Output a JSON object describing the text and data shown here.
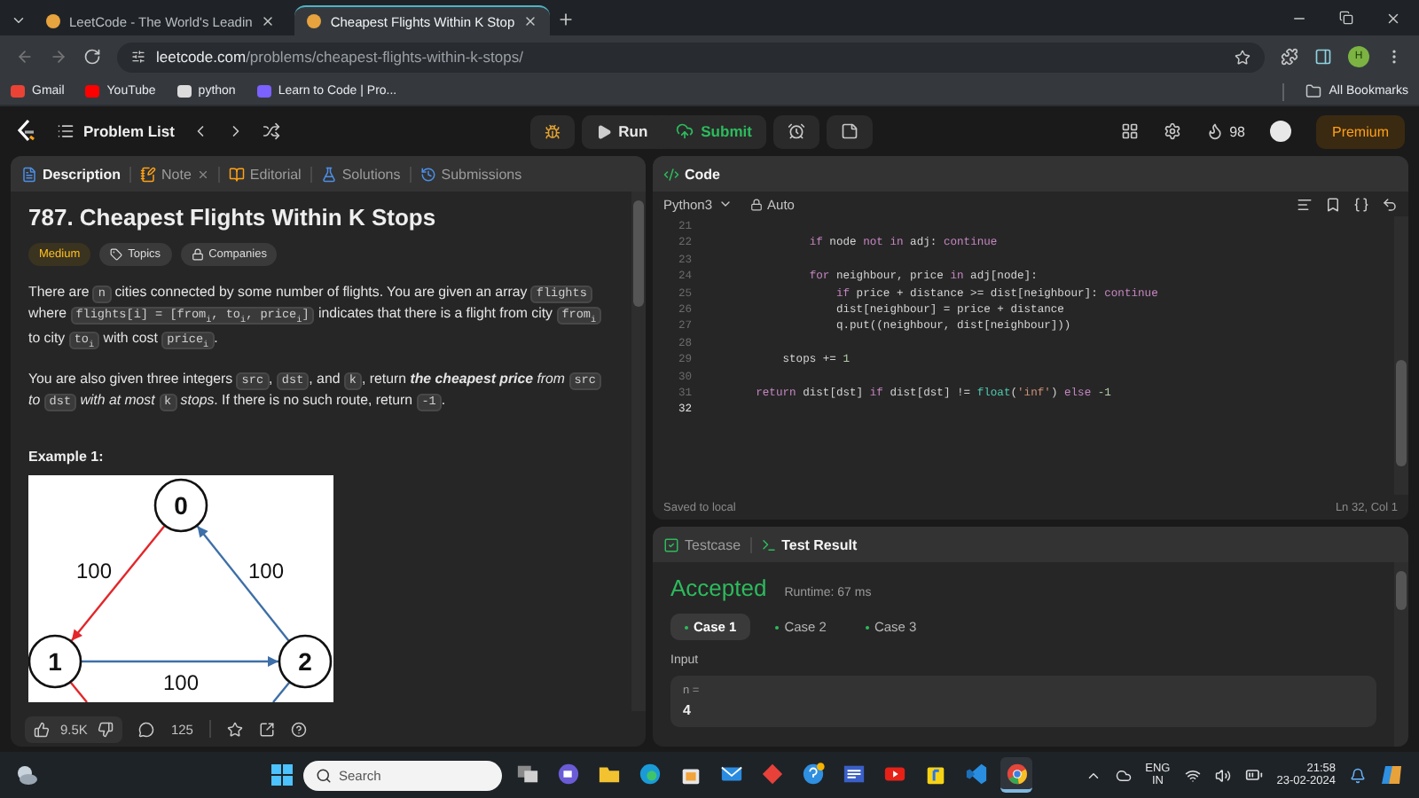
{
  "browser": {
    "tabs": [
      {
        "title": "LeetCode - The World's Leadin",
        "selected": false
      },
      {
        "title": "Cheapest Flights Within K Stop",
        "selected": true
      }
    ],
    "address": {
      "domain": "leetcode.com",
      "path": "/problems/cheapest-flights-within-k-stops/"
    },
    "profile_initial": "H",
    "bookmarks": [
      {
        "label": "Gmail",
        "kind": "gmail"
      },
      {
        "label": "YouTube",
        "kind": "youtube"
      },
      {
        "label": "python",
        "kind": "page"
      },
      {
        "label": "Learn to Code | Pro...",
        "kind": "learn"
      }
    ],
    "all_bookmarks": "All Bookmarks"
  },
  "navbar": {
    "problem_list": "Problem List",
    "run": "Run",
    "submit": "Submit",
    "streak": "98",
    "premium": "Premium"
  },
  "description": {
    "tabs": [
      {
        "label": "Description",
        "kind": "description",
        "selected": true
      },
      {
        "label": "Note",
        "kind": "note",
        "selected": false
      },
      {
        "label": "Editorial",
        "kind": "editorial",
        "selected": false
      },
      {
        "label": "Solutions",
        "kind": "solutions",
        "selected": false
      },
      {
        "label": "Submissions",
        "kind": "submissions",
        "selected": false
      }
    ],
    "title": "787. Cheapest Flights Within K Stops",
    "tags": [
      {
        "label": "Medium",
        "kind": "difficulty"
      },
      {
        "label": "Topics",
        "kind": "topics"
      },
      {
        "label": "Companies",
        "kind": "companies"
      }
    ],
    "paragraphs": [
      [
        {
          "kind": "text",
          "text": "There are "
        },
        {
          "kind": "code",
          "text": "n"
        },
        {
          "kind": "text",
          "text": " cities connected by some number of flights. You are given an array "
        },
        {
          "kind": "code",
          "text": "flights"
        },
        {
          "kind": "text",
          "text": " where "
        },
        {
          "kind": "code",
          "text": "flights[i] = [from$_{i}$, to$_{i}$, price$_{i}$]"
        },
        {
          "kind": "text",
          "text": " indicates that there is a flight from city "
        },
        {
          "kind": "code",
          "text": "from$_{i}$"
        },
        {
          "kind": "text",
          "text": " to city "
        },
        {
          "kind": "code",
          "text": "to$_{i}$"
        },
        {
          "kind": "text",
          "text": " with cost "
        },
        {
          "kind": "code",
          "text": "price$_{i}$"
        },
        {
          "kind": "text",
          "text": "."
        }
      ],
      [
        {
          "kind": "text",
          "text": "You are also given three integers "
        },
        {
          "kind": "code",
          "text": "src"
        },
        {
          "kind": "text",
          "text": ", "
        },
        {
          "kind": "code",
          "text": "dst"
        },
        {
          "kind": "text",
          "text": ", and "
        },
        {
          "kind": "code",
          "text": "k"
        },
        {
          "kind": "text",
          "text": ", return "
        },
        {
          "kind": "strong",
          "text": "the cheapest price"
        },
        {
          "kind": "italic",
          "text": " from "
        },
        {
          "kind": "code",
          "text": "src"
        },
        {
          "kind": "italic",
          "text": " to "
        },
        {
          "kind": "code",
          "text": "dst"
        },
        {
          "kind": "italic",
          "text": " with at most "
        },
        {
          "kind": "code",
          "text": "k"
        },
        {
          "kind": "italic",
          "text": " stops"
        },
        {
          "kind": "text",
          "text": ". If there is no such route, return "
        },
        {
          "kind": "code",
          "text": "-1"
        },
        {
          "kind": "text",
          "text": "."
        }
      ]
    ],
    "example_heading": "Example 1:",
    "graph": {
      "nodes": [
        {
          "label": "0"
        },
        {
          "label": "1"
        },
        {
          "label": "2"
        }
      ],
      "edges": [
        {
          "label": "100",
          "color": "#e3262a"
        },
        {
          "label": "100",
          "color": "#3d6fa8"
        },
        {
          "label": "100",
          "color": "#3d6fa8"
        }
      ]
    },
    "likes": "9.5K",
    "comments": "125"
  },
  "editor": {
    "title": "Code",
    "language": "Python3",
    "mode": "Auto",
    "lines": [
      {
        "number": "21",
        "current": false
      },
      {
        "number": "22",
        "current": false,
        "segments": [
          {
            "kind": "kw",
            "text": "            if"
          },
          {
            "kind": "plain",
            "text": " node "
          },
          {
            "kind": "kw",
            "text": "not in"
          },
          {
            "kind": "plain",
            "text": " adj: "
          },
          {
            "kind": "kw",
            "text": "continue"
          }
        ]
      },
      {
        "number": "23",
        "current": false
      },
      {
        "number": "24",
        "current": false,
        "segments": [
          {
            "kind": "kw",
            "text": "            for"
          },
          {
            "kind": "plain",
            "text": " neighbour, price "
          },
          {
            "kind": "kw",
            "text": "in"
          },
          {
            "kind": "plain",
            "text": " adj[node]:"
          }
        ]
      },
      {
        "number": "25",
        "current": false,
        "segments": [
          {
            "kind": "kw",
            "text": "                if"
          },
          {
            "kind": "plain",
            "text": " price + distance >= dist[neighbour]: "
          },
          {
            "kind": "kw",
            "text": "continue"
          }
        ]
      },
      {
        "number": "26",
        "current": false,
        "segments": [
          {
            "kind": "plain",
            "text": "                dist[neighbour] = price + distance"
          }
        ]
      },
      {
        "number": "27",
        "current": false,
        "segments": [
          {
            "kind": "plain",
            "text": "                q.put((neighbour, dist[neighbour]))"
          }
        ]
      },
      {
        "number": "28",
        "current": false
      },
      {
        "number": "29",
        "current": false,
        "segments": [
          {
            "kind": "plain",
            "text": "        stops += "
          },
          {
            "kind": "num",
            "text": "1"
          }
        ]
      },
      {
        "number": "30",
        "current": false
      },
      {
        "number": "31",
        "current": false,
        "segments": [
          {
            "kind": "kw",
            "text": "    return"
          },
          {
            "kind": "plain",
            "text": " dist[dst] "
          },
          {
            "kind": "kw",
            "text": "if"
          },
          {
            "kind": "plain",
            "text": " dist[dst] != "
          },
          {
            "kind": "fn",
            "text": "float"
          },
          {
            "kind": "plain",
            "text": "("
          },
          {
            "kind": "str",
            "text": "'inf'"
          },
          {
            "kind": "plain",
            "text": ") "
          },
          {
            "kind": "kw",
            "text": "else"
          },
          {
            "kind": "num",
            "text": " -1"
          }
        ]
      },
      {
        "number": "32",
        "current": true
      }
    ],
    "status": "Saved to local",
    "cursor": "Ln 32, Col 1"
  },
  "results": {
    "tabs": [
      {
        "label": "Testcase",
        "kind": "testcase",
        "selected": false
      },
      {
        "label": "Test Result",
        "kind": "result",
        "selected": true
      }
    ],
    "verdict": "Accepted",
    "runtime": "Runtime: 67 ms",
    "cases": [
      {
        "label": "Case 1",
        "selected": true
      },
      {
        "label": "Case 2",
        "selected": false
      },
      {
        "label": "Case 3",
        "selected": false
      }
    ],
    "input_label": "Input",
    "inputs": [
      {
        "name": "n =",
        "value": "4"
      }
    ]
  },
  "taskbar": {
    "search_placeholder": "Search",
    "apps": [
      {
        "kind": "task-view",
        "active": false
      },
      {
        "kind": "meet",
        "active": false
      },
      {
        "kind": "folder",
        "active": false
      },
      {
        "kind": "edge",
        "active": false
      },
      {
        "kind": "store",
        "active": false
      },
      {
        "kind": "mail",
        "active": false
      },
      {
        "kind": "diamond",
        "active": false
      },
      {
        "kind": "help",
        "active": false
      },
      {
        "kind": "news",
        "active": false
      },
      {
        "kind": "youtube",
        "active": false
      },
      {
        "kind": "flipkart",
        "active": false
      },
      {
        "kind": "vscode",
        "active": false
      },
      {
        "kind": "chrome",
        "active": true
      }
    ],
    "language": [
      "ENG",
      "IN"
    ],
    "time": "21:58",
    "date": "23-02-2024"
  }
}
